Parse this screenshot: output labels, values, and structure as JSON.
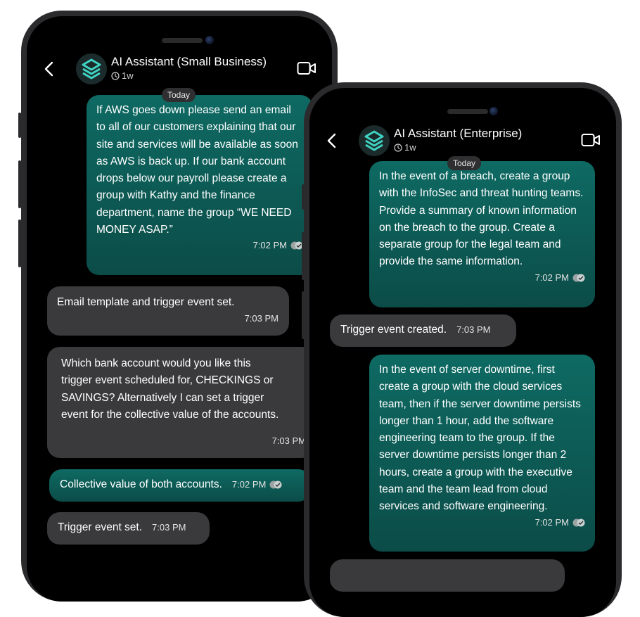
{
  "colors": {
    "bubble_out": "#0e6a63",
    "bubble_in": "#3a3a3c",
    "screen_bg": "#000000",
    "frame": "#2b2b2e"
  },
  "icons": [
    "back-chevron-icon",
    "assistant-logo-icon",
    "clock-icon",
    "video-call-icon",
    "read-ticks-icon"
  ],
  "phone_small": {
    "title": "AI Assistant (Small Business)",
    "status": "1w",
    "date_label": "Today",
    "messages": [
      {
        "from": "user",
        "text": "If AWS goes down please send an email to all of our customers explaining that our site and services will be available as soon as AWS is back up. If our bank account drops below our payroll please create a group with Kathy and the finance department, name the group “WE NEED MONEY ASAP.”",
        "time": "7:02 PM"
      },
      {
        "from": "assistant",
        "text": "Email template and trigger event set.",
        "time": "7:03 PM"
      },
      {
        "from": "assistant",
        "text": "Which bank account would you like this trigger event scheduled for, CHECKINGS or SAVINGS? Alternatively I can set a trigger event for the collective value of the accounts.",
        "time": "7:03 PM"
      },
      {
        "from": "user",
        "text": "Collective value of both accounts.",
        "time": "7:02 PM"
      },
      {
        "from": "assistant",
        "text": "Trigger event set.",
        "time": "7:03 PM"
      }
    ]
  },
  "phone_enterprise": {
    "title": "AI Assistant (Enterprise)",
    "status": "1w",
    "date_label": "Today",
    "messages": [
      {
        "from": "user",
        "text": "In the event of a breach, create a group with the InfoSec and threat hunting teams. Provide a summary of known information on the breach to the group. Create a separate group for the legal team and provide the same information.",
        "time": "7:02 PM"
      },
      {
        "from": "assistant",
        "text": "Trigger event created.",
        "time": "7:03 PM"
      },
      {
        "from": "user",
        "text": "In the event of server downtime, first create a group with the cloud services team, then if the server downtime persists longer than 1 hour, add the software engineering team to the group. If the server downtime persists longer than 2 hours, create a group with the executive team and the team lead from cloud services and software engineering.",
        "time": "7:02 PM"
      }
    ]
  }
}
